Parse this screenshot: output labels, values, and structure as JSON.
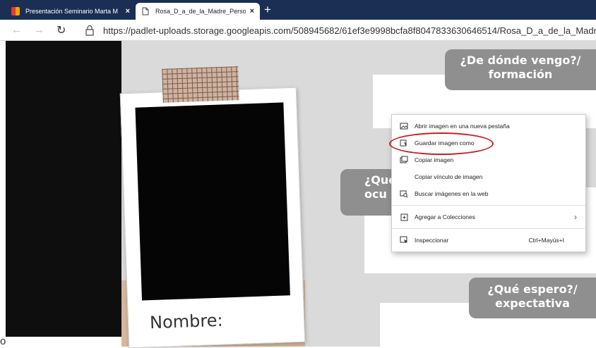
{
  "tabs": [
    {
      "title": "Presentación Seminario Marta M",
      "close_label": "×",
      "favicon": "windows-colored-icon"
    },
    {
      "title": "Rosa_D_a_de_la_Madre_Personal",
      "close_label": "×",
      "favicon": "page-icon"
    }
  ],
  "new_tab_label": "+",
  "nav": {
    "back": "←",
    "forward": "→",
    "reload": "↻"
  },
  "address_bar": {
    "url": "https://padlet-uploads.storage.googleapis.com/508945682/61ef3e9998bcfa8f8047833630646514/Rosa_D_a_de_la_Madre_Personal_"
  },
  "poster": {
    "heading_top": [
      "¿De dónde vengo?/",
      "formación"
    ],
    "heading_mid": [
      "¿Qué",
      "ocu"
    ],
    "heading_bottom": [
      "¿Qué espero?/",
      "expectativa"
    ],
    "name_label": "Nombre:"
  },
  "stray_char": "o",
  "context_menu": {
    "items": [
      {
        "label": "Abrir imagen en una nueva pestaña",
        "icon": "open-image-icon"
      },
      {
        "label": "Guardar imagen como",
        "icon": "save-image-icon",
        "highlighted": true
      },
      {
        "label": "Copiar imagen",
        "icon": "copy-image-icon"
      },
      {
        "label": "Copiar vínculo de imagen",
        "icon": null
      },
      {
        "label": "Buscar imágenes en la web",
        "icon": "search-images-icon"
      },
      {
        "label": "Agregar a Colecciones",
        "icon": "collections-icon",
        "arrow": "›"
      },
      {
        "label": "Inspeccionar",
        "icon": "inspect-icon",
        "shortcut": "Ctrl+Mayús+I"
      }
    ]
  },
  "colors": {
    "tabbar": "#1b2f55",
    "poster_bg": "#dadada",
    "ribbon": "#8f8f8f",
    "highlight": "#c62026"
  }
}
